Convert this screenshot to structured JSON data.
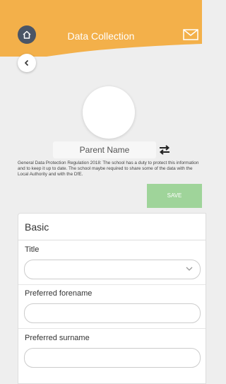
{
  "header": {
    "title": "Data Collection",
    "bg_color": "#f3b04a",
    "icons": [
      "home-icon",
      "mail-icon"
    ]
  },
  "back_icon": "chevron-left-icon",
  "profile": {
    "name": "Parent Name",
    "swap_icon": "swap-arrows-icon"
  },
  "gdpr_text": "General Data Protection Regulation 2018: The school has a duty to protect this information and to keep it up to date. The school maybe required to share some of the data with the Local Authority and with the DfE.",
  "save_label": "SAVE",
  "save_color": "#9fd49a",
  "form": {
    "section_title": "Basic",
    "fields": [
      {
        "label": "Title",
        "value": "",
        "type": "select"
      },
      {
        "label": "Preferred forename",
        "value": ""
      },
      {
        "label": "Preferred surname",
        "value": ""
      }
    ]
  }
}
